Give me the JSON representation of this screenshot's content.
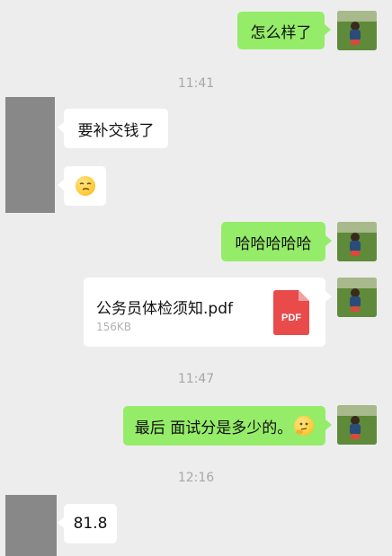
{
  "messages": {
    "m1": "怎么样了",
    "m2": "要补交钱了",
    "m4": "哈哈哈哈哈",
    "m6": "最后 面试分是多少的。",
    "m7": "81.8"
  },
  "timestamps": {
    "t1": "11:41",
    "t2": "11:47",
    "t3": "12:16"
  },
  "file": {
    "name": "公务员体检须知.pdf",
    "size": "156KB",
    "icon_label": "PDF",
    "icon_color": "#e94b4b"
  },
  "colors": {
    "background": "#ededed",
    "self_bubble": "#95ec69",
    "other_bubble": "#ffffff"
  },
  "icons": {
    "thinking_emoji": "thinking-face-emoji",
    "squint_emoji": "squinting-face-emoji"
  }
}
